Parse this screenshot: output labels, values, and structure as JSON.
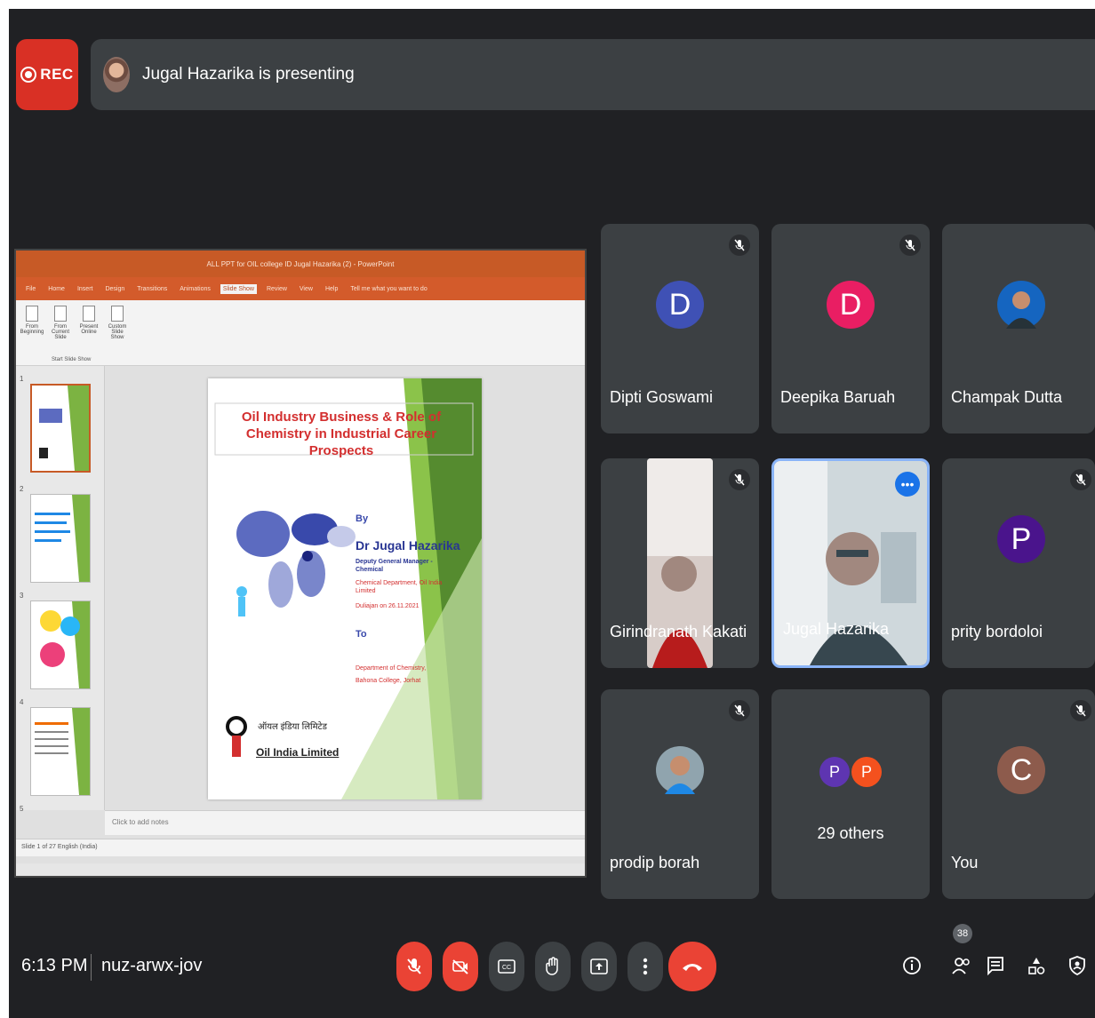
{
  "recording": {
    "label": "REC"
  },
  "presenter_bar": {
    "text": "Jugal Hazarika is presenting"
  },
  "presentation": {
    "window_title": "ALL PPT for OIL college ID Jugal Hazarika (2) - PowerPoint",
    "tabs": [
      "File",
      "Home",
      "Insert",
      "Design",
      "Transitions",
      "Animations",
      "Slide Show",
      "Review",
      "View",
      "Help",
      "Tell me what you want to do"
    ],
    "active_tab": "Slide Show",
    "ribbon_buttons": [
      "From Beginning",
      "From Current Slide",
      "Present Online",
      "Custom Slide Show"
    ],
    "ribbon_group": "Start Slide Show",
    "slide": {
      "title": "Oil Industry Business & Role of Chemistry in Industrial Career Prospects",
      "by": "By",
      "speaker": "Dr Jugal Hazarika",
      "designation": "Deputy General Manager - Chemical",
      "department": "Chemical Department, Oil India Limited",
      "date_line": "Duliajan on 26.11.2021",
      "to": "To",
      "venue": "Department of Chemistry, Bahona College, Jorhat",
      "org_hindi": "ऑयल इंडिया लिमिटेड",
      "org_name": "Oil India Limited"
    },
    "thumb_numbers": [
      "1",
      "2",
      "3",
      "4",
      "5"
    ],
    "notes_placeholder": "Click to add notes",
    "status_bar": "Slide 1 of 27   English (India)"
  },
  "participants": [
    {
      "name": "Dipti Goswami",
      "initial": "D",
      "color": "#3f51b5",
      "muted": true
    },
    {
      "name": "Deepika Baruah",
      "initial": "D",
      "color": "#e91e63",
      "muted": true
    },
    {
      "name": "Champak Dutta",
      "initial": "",
      "color": "",
      "muted": false
    },
    {
      "name": "Girindranath Kakati",
      "initial": "",
      "color": "",
      "muted": true
    },
    {
      "name": "Jugal Hazarika",
      "initial": "",
      "color": "",
      "muted": false
    },
    {
      "name": "prity bordoloi",
      "initial": "P",
      "color": "#4a148c",
      "muted": true
    },
    {
      "name": "prodip borah",
      "initial": "",
      "color": "",
      "muted": true
    },
    {
      "name": "",
      "initial": "",
      "color": "",
      "muted": false
    },
    {
      "name": "You",
      "initial": "C",
      "color": "#8d5b4c",
      "muted": true
    }
  ],
  "others_tile": {
    "count_label": "29 others",
    "mini1": "P",
    "mini1_color": "#5e35b1",
    "mini2": "P",
    "mini2_color": "#f4511e"
  },
  "bottom_bar": {
    "time": "6:13 PM",
    "meeting_code": "nuz-arwx-jov",
    "people_count": "38"
  },
  "icons": {
    "mic_off": "mic-off-icon",
    "cam_off": "camera-off-icon",
    "captions": "captions-icon",
    "raise_hand": "raise-hand-icon",
    "present": "present-now-icon",
    "more": "more-options-icon",
    "end": "end-call-icon",
    "info": "info-icon",
    "people": "people-icon",
    "chat": "chat-icon",
    "activities": "activities-icon",
    "security": "host-controls-icon"
  }
}
